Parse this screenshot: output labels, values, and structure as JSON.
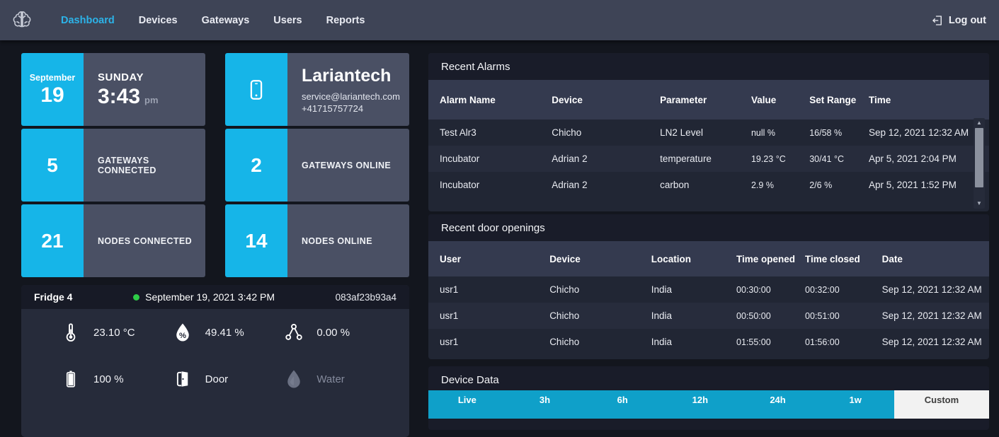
{
  "nav": {
    "items": [
      {
        "label": "Dashboard",
        "active": true
      },
      {
        "label": "Devices",
        "active": false
      },
      {
        "label": "Gateways",
        "active": false
      },
      {
        "label": "Users",
        "active": false
      },
      {
        "label": "Reports",
        "active": false
      }
    ],
    "logout_label": "Log out"
  },
  "info_cards": {
    "date": {
      "month": "September",
      "day": "19",
      "weekday": "SUNDAY",
      "time": "3:43",
      "meridiem": "pm"
    },
    "company": {
      "name": "Lariantech",
      "email": "service@lariantech.com",
      "phone": "+41715757724"
    },
    "stats": [
      {
        "value": "5",
        "label": "GATEWAYS CONNECTED"
      },
      {
        "value": "2",
        "label": "GATEWAYS ONLINE"
      },
      {
        "value": "21",
        "label": "NODES CONNECTED"
      },
      {
        "value": "14",
        "label": "NODES ONLINE"
      }
    ]
  },
  "device_panel": {
    "name": "Fridge 4",
    "timestamp": "September 19, 2021 3:42 PM",
    "device_id": "083af23b93a4",
    "sensors": [
      {
        "icon": "thermometer-icon",
        "value": "23.10 °C"
      },
      {
        "icon": "humidity-icon",
        "value": "49.41 %"
      },
      {
        "icon": "co2-nodes-icon",
        "value": "0.00 %"
      },
      {
        "icon": "battery-icon",
        "value": "100 %"
      },
      {
        "icon": "door-icon",
        "value": "Door"
      },
      {
        "icon": "water-icon",
        "value": "Water"
      }
    ]
  },
  "alarms": {
    "title": "Recent Alarms",
    "columns": [
      "Alarm Name",
      "Device",
      "Parameter",
      "Value",
      "Set Range",
      "Time"
    ],
    "rows": [
      [
        "Test Alr3",
        "Chicho",
        "LN2 Level",
        "null %",
        "16/58 %",
        "Sep 12, 2021 12:32 AM"
      ],
      [
        "Incubator",
        "Adrian 2",
        "temperature",
        "19.23 °C",
        "30/41 °C",
        "Apr 5, 2021 2:04 PM"
      ],
      [
        "Incubator",
        "Adrian 2",
        "carbon",
        "2.9 %",
        "2/6 %",
        "Apr 5, 2021 1:52 PM"
      ]
    ]
  },
  "door_openings": {
    "title": "Recent door openings",
    "columns": [
      "User",
      "Device",
      "Location",
      "Time opened",
      "Time closed",
      "Date"
    ],
    "rows": [
      [
        "usr1",
        "Chicho",
        "India",
        "00:30:00",
        "00:32:00",
        "Sep 12, 2021 12:32 AM"
      ],
      [
        "usr1",
        "Chicho",
        "India",
        "00:50:00",
        "00:51:00",
        "Sep 12, 2021 12:32 AM"
      ],
      [
        "usr1",
        "Chicho",
        "India",
        "01:55:00",
        "01:56:00",
        "Sep 12, 2021 12:32 AM"
      ]
    ]
  },
  "device_data": {
    "title": "Device Data",
    "ranges": [
      "Live",
      "3h",
      "6h",
      "12h",
      "24h",
      "1w"
    ],
    "custom_label": "Custom"
  },
  "icons": {
    "scroll_up": "▲",
    "scroll_down": "▼"
  },
  "colors": {
    "accent": "#16b5e8",
    "nav_active": "#2cb3e8",
    "range_bar": "#0fa0c9",
    "online_green": "#2ecc47",
    "custom_button_bg": "#f2f2f2"
  }
}
